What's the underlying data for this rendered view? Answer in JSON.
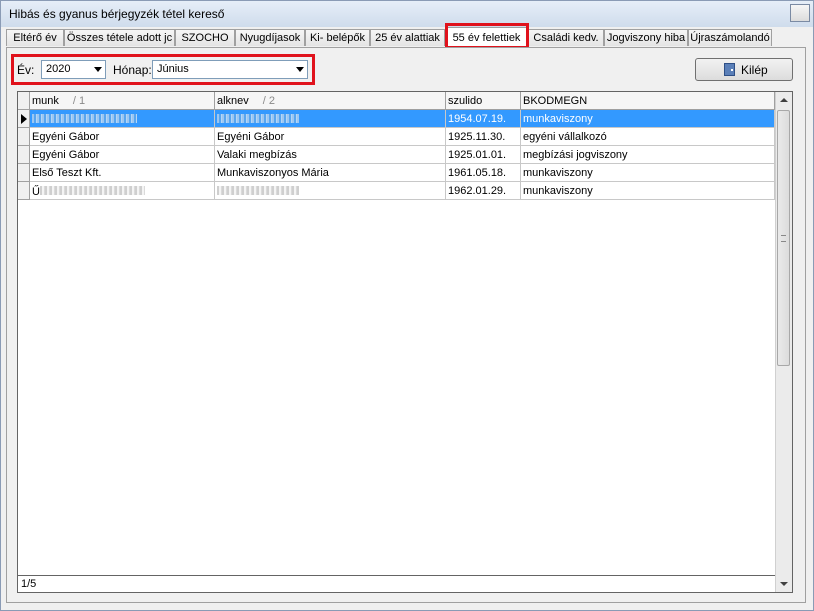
{
  "window": {
    "title": "Hibás és gyanus bérjegyzék tétel kereső"
  },
  "tabs": [
    {
      "label": "Eltérő év"
    },
    {
      "label": "Összes tétele adott jc"
    },
    {
      "label": "SZOCHO"
    },
    {
      "label": "Nyugdíjasok"
    },
    {
      "label": "Ki- belépők"
    },
    {
      "label": "25 év alattiak"
    },
    {
      "label": "55 év felettiek",
      "active": true
    },
    {
      "label": "Családi kedv."
    },
    {
      "label": "Jogviszony hiba"
    },
    {
      "label": "Újraszámolandó"
    }
  ],
  "filter": {
    "year_label": "Év:",
    "year_value": "2020",
    "month_label": "Hónap:",
    "month_value": "Június"
  },
  "toolbar": {
    "exit_label": "Kilép",
    "exit_icon": "door-exit-icon"
  },
  "grid": {
    "columns": [
      {
        "label": "munk",
        "sort": "/ 1"
      },
      {
        "label": "alknev",
        "sort": "/ 2"
      },
      {
        "label": "szulido",
        "sort": ""
      },
      {
        "label": "BKODMEGN",
        "sort": ""
      }
    ],
    "rows": [
      {
        "munk": "",
        "alknev": "",
        "szulido": "1954.07.19.",
        "bkod": "munkaviszony",
        "selected": true,
        "current": true,
        "blur": true
      },
      {
        "munk": "Egyéni Gábor",
        "alknev": "Egyéni Gábor",
        "szulido": "1925.11.30.",
        "bkod": "egyéni vállalkozó"
      },
      {
        "munk": "Egyéni Gábor",
        "alknev": "Valaki megbízás",
        "szulido": "1925.01.01.",
        "bkod": "megbízási jogviszony"
      },
      {
        "munk": "Első Teszt Kft.",
        "alknev": "Munkaviszonyos Mária",
        "szulido": "1961.05.18.",
        "bkod": "munkaviszony"
      },
      {
        "munk": "Ű",
        "alknev": "",
        "szulido": "1962.01.29.",
        "bkod": "munkaviszony",
        "blur": true
      }
    ],
    "record_counter": "1/5"
  },
  "colors": {
    "highlight": "#e0121c",
    "selection": "#3399ff"
  }
}
